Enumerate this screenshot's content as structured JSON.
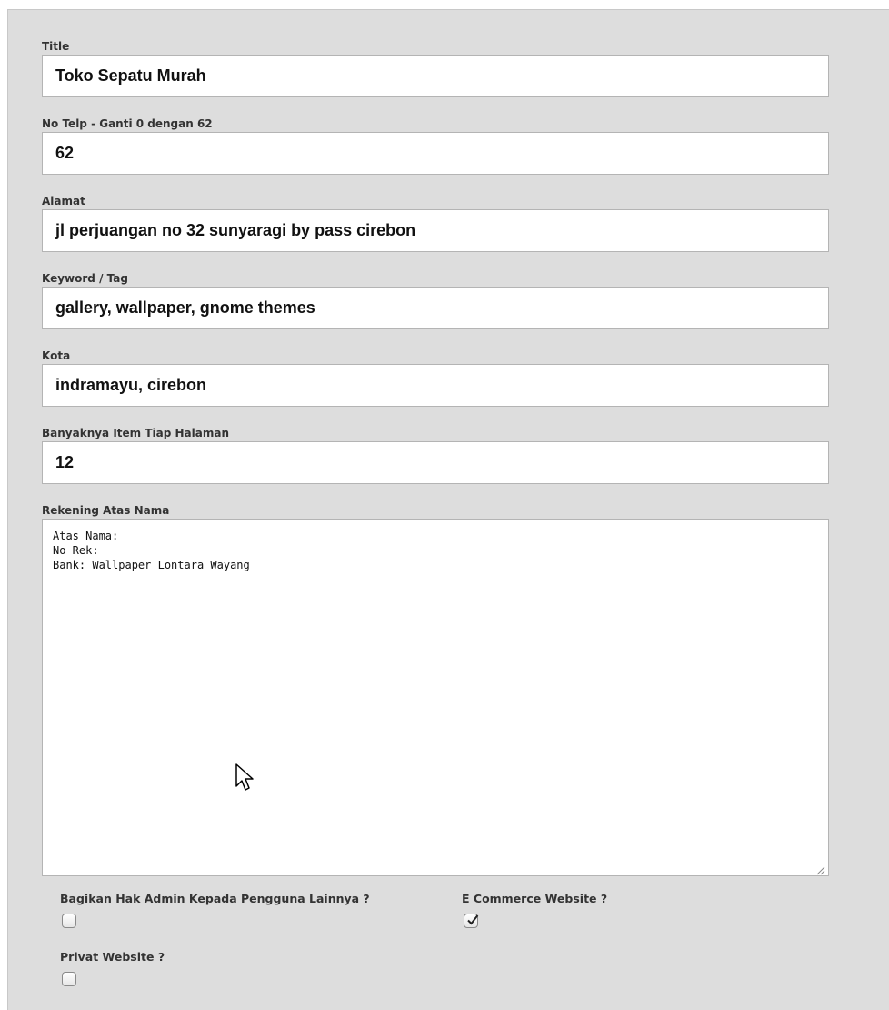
{
  "form": {
    "fields": [
      {
        "label": "Title",
        "value": "Toko Sepatu Murah"
      },
      {
        "label": "No Telp - Ganti 0 dengan 62",
        "value": "62"
      },
      {
        "label": "Alamat",
        "value": "jl perjuangan no 32 sunyaragi by pass cirebon"
      },
      {
        "label": "Keyword / Tag",
        "value": "gallery, wallpaper, gnome themes"
      },
      {
        "label": "Kota",
        "value": "indramayu, cirebon"
      },
      {
        "label": "Banyaknya Item Tiap Halaman",
        "value": "12"
      }
    ],
    "rekening": {
      "label": "Rekening Atas Nama",
      "value": "Atas Nama:\nNo Rek:\nBank: Wallpaper Lontara Wayang"
    },
    "checkboxes": [
      {
        "label": "Bagikan Hak Admin Kepada Pengguna Lainnya ?",
        "checked": false
      },
      {
        "label": "E Commerce Website ?",
        "checked": true
      },
      {
        "label": "Privat Website ?",
        "checked": false
      }
    ]
  },
  "icons": {
    "checkmark": "checkmark-icon",
    "resize": "resize-grip-icon",
    "cursor": "mouse-pointer-icon"
  }
}
